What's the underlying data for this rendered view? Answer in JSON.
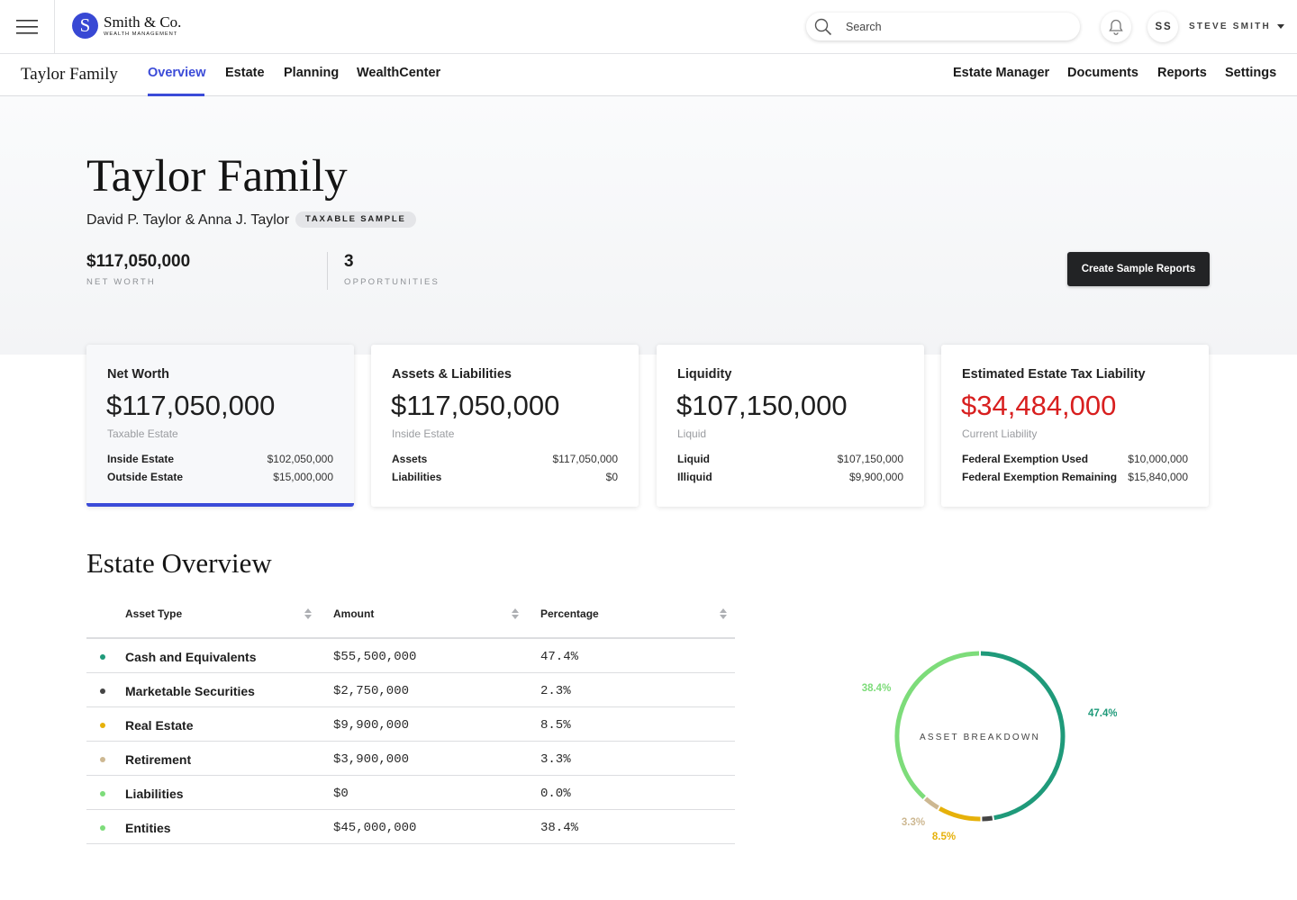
{
  "brand": {
    "logo_letter": "S",
    "name": "Smith & Co.",
    "subtitle": "WEALTH MANAGEMENT",
    "color": "#3848d4"
  },
  "search": {
    "placeholder": "Search",
    "value": ""
  },
  "user": {
    "initials": "SS",
    "name": "STEVE SMITH"
  },
  "nav": {
    "family": "Taylor Family",
    "tabs": [
      {
        "label": "Overview",
        "active": true
      },
      {
        "label": "Estate"
      },
      {
        "label": "Planning"
      },
      {
        "label": "WealthCenter"
      }
    ],
    "right": [
      {
        "label": "Estate Manager"
      },
      {
        "label": "Documents"
      },
      {
        "label": "Reports"
      },
      {
        "label": "Settings"
      }
    ],
    "accent": "#3b4bd8"
  },
  "hero": {
    "title": "Taylor Family",
    "members": "David P. Taylor & Anna J. Taylor",
    "badge": "TAXABLE SAMPLE",
    "stats": [
      {
        "value": "$117,050,000",
        "label": "NET WORTH"
      },
      {
        "value": "3",
        "label": "OPPORTUNITIES"
      }
    ],
    "action_label": "Create Sample Reports"
  },
  "cards": [
    {
      "title": "Net Worth",
      "value": "$117,050,000",
      "sub": "Taxable Estate",
      "selected": true,
      "rows": [
        {
          "k": "Inside Estate",
          "v": "$102,050,000"
        },
        {
          "k": "Outside Estate",
          "v": "$15,000,000"
        }
      ]
    },
    {
      "title": "Assets & Liabilities",
      "value": "$117,050,000",
      "sub": "Inside Estate",
      "rows": [
        {
          "k": "Assets",
          "v": "$117,050,000"
        },
        {
          "k": "Liabilities",
          "v": "$0"
        }
      ]
    },
    {
      "title": "Liquidity",
      "value": "$107,150,000",
      "sub": "Liquid",
      "rows": [
        {
          "k": "Liquid",
          "v": "$107,150,000"
        },
        {
          "k": "Illiquid",
          "v": "$9,900,000"
        }
      ]
    },
    {
      "title": "Estimated Estate Tax Liability",
      "value": "$34,484,000",
      "value_color": "#d81f1f",
      "sub": "Current Liability",
      "rows": [
        {
          "k": "Federal Exemption Used",
          "v": "$10,000,000"
        },
        {
          "k": "Federal Exemption Remaining",
          "v": "$15,840,000"
        }
      ]
    }
  ],
  "estate_overview": {
    "title": "Estate Overview",
    "columns": [
      "Asset Type",
      "Amount",
      "Percentage"
    ],
    "rows": [
      {
        "type": "Cash and Equivalents",
        "amount": "$55,500,000",
        "pct": "47.4%",
        "color": "#1f9a7a"
      },
      {
        "type": "Marketable Securities",
        "amount": "$2,750,000",
        "pct": "2.3%",
        "color": "#444444"
      },
      {
        "type": "Real Estate",
        "amount": "$9,900,000",
        "pct": "8.5%",
        "color": "#e6b10a"
      },
      {
        "type": "Retirement",
        "amount": "$3,900,000",
        "pct": "3.3%",
        "color": "#cdb892"
      },
      {
        "type": "Liabilities",
        "amount": "$0",
        "pct": "0.0%",
        "color": "#7ddc7a"
      },
      {
        "type": "Entities",
        "amount": "$45,000,000",
        "pct": "38.4%",
        "color": "#7ddc7a"
      }
    ]
  },
  "chart_data": {
    "type": "pie",
    "title": "",
    "center_label": "ASSET BREAKDOWN",
    "categories": [
      "Cash and Equivalents",
      "Marketable Securities",
      "Real Estate",
      "Retirement",
      "Liabilities",
      "Entities"
    ],
    "values": [
      47.4,
      2.3,
      8.5,
      3.3,
      0.0,
      38.4
    ],
    "colors": [
      "#1f9a7a",
      "#444444",
      "#e6b10a",
      "#cdb892",
      "#7ddc7a",
      "#7ddc7a"
    ],
    "data_labels": [
      "47.4%",
      "",
      "8.5%",
      "3.3%",
      "",
      "38.4%"
    ],
    "label_colors": [
      "#1f9a7a",
      "#444444",
      "#e6b10a",
      "#cdb892",
      "#7ddc7a",
      "#7ddc7a"
    ]
  }
}
